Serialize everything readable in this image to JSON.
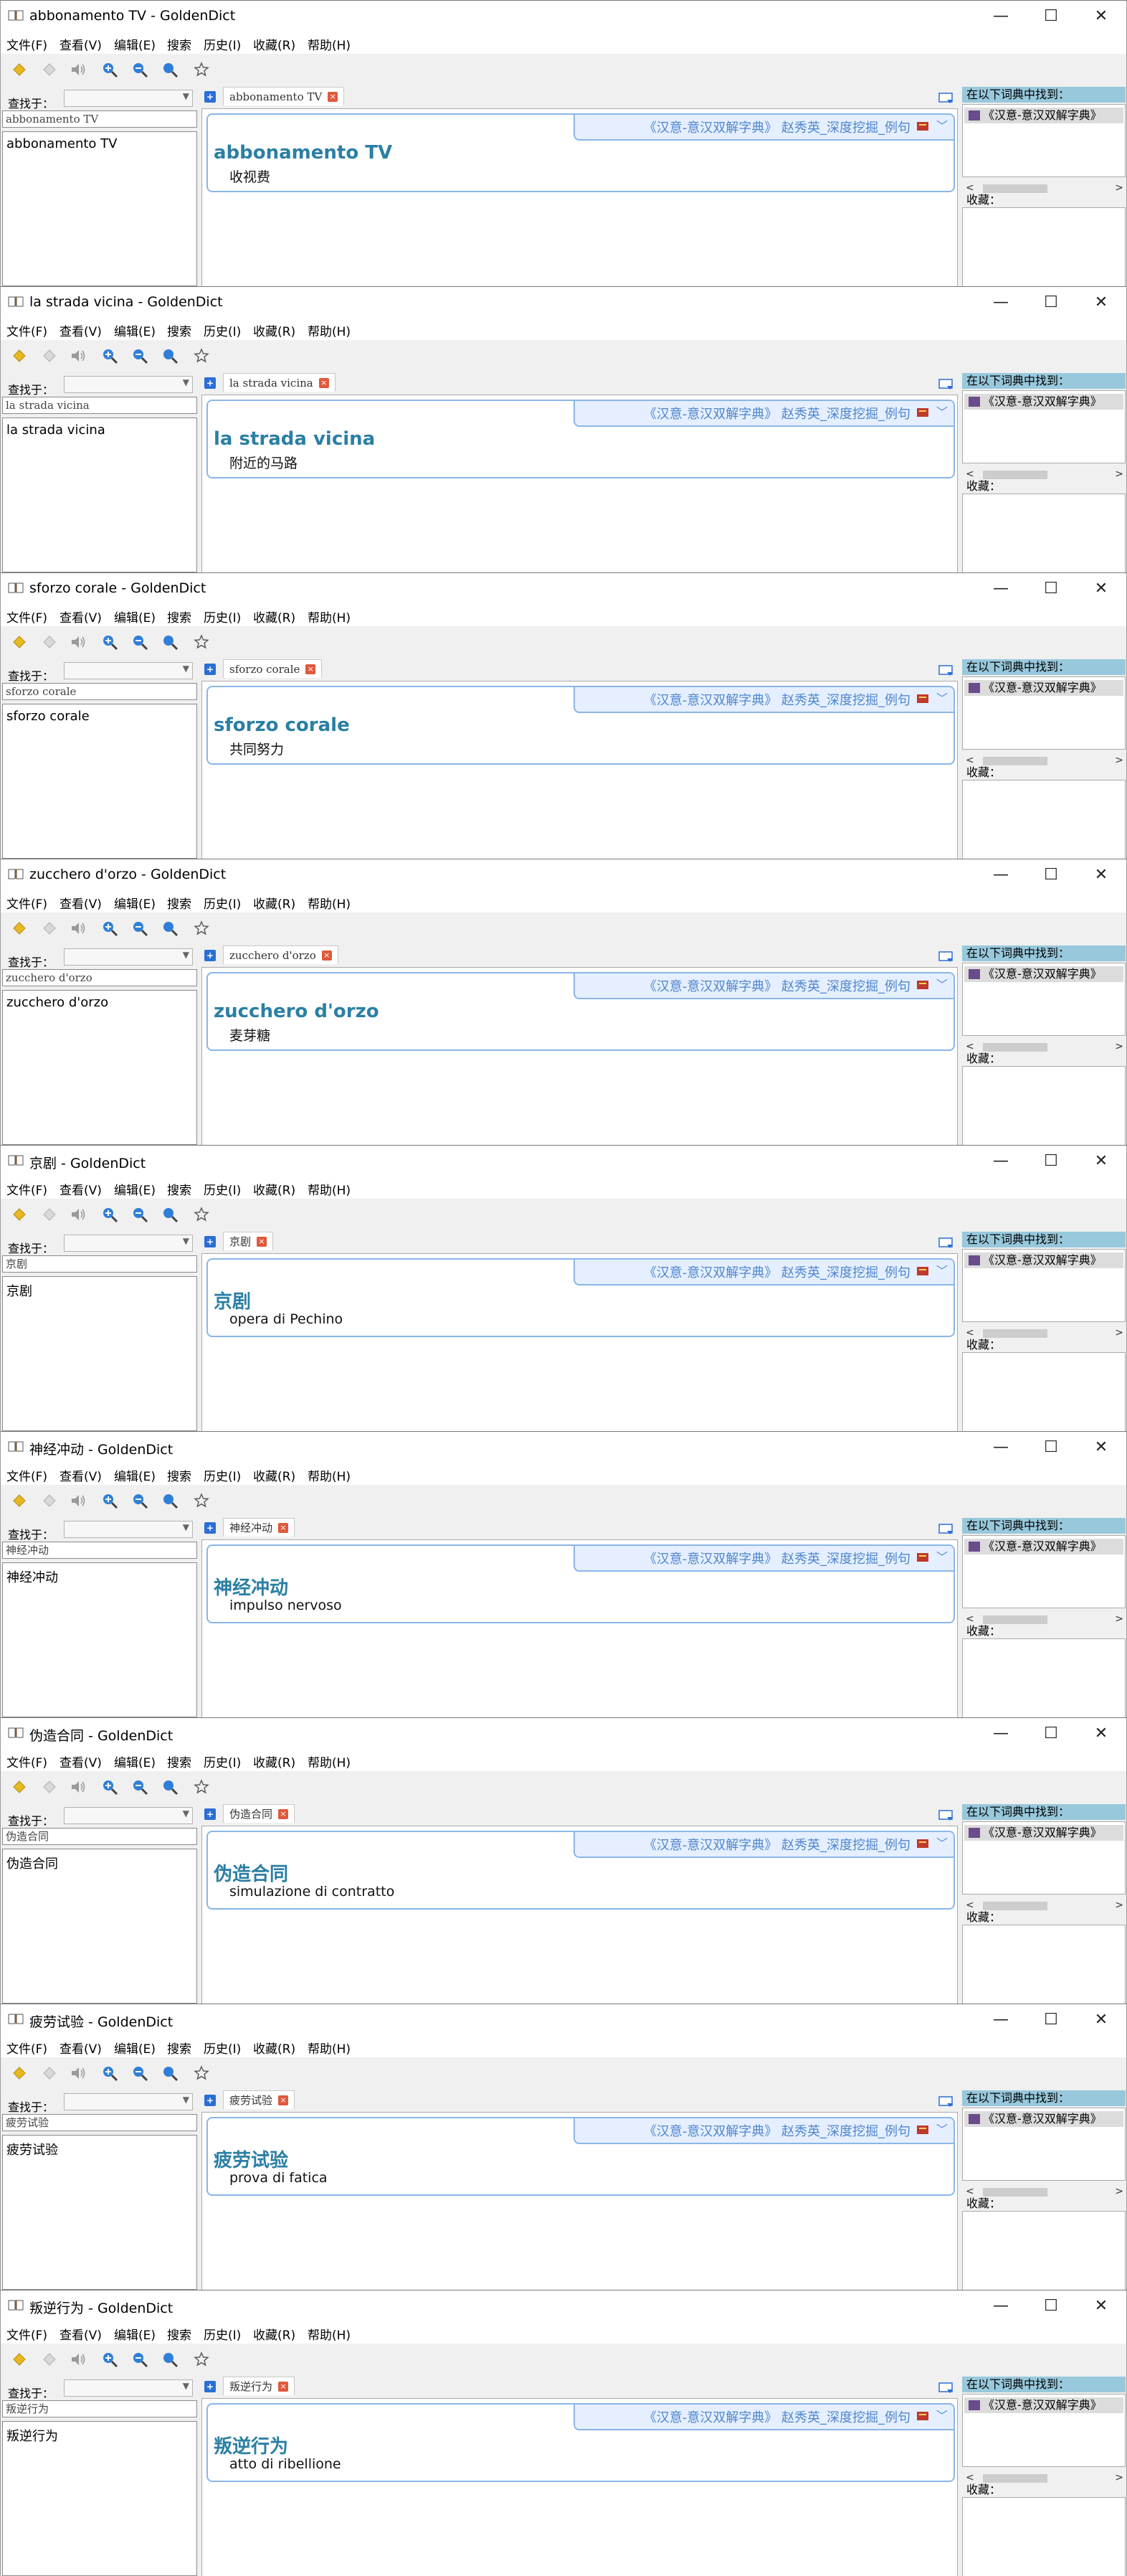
{
  "app": {
    "title_suffix": " - GoldenDict",
    "menu": [
      "文件(F)",
      "查看(V)",
      "编辑(E)",
      "搜索",
      "历史(I)",
      "收藏(R)",
      "帮助(H)"
    ],
    "window_buttons": {
      "minimize": "—",
      "maximize": "☐",
      "close": "✕"
    },
    "look_in_label": "查找于：",
    "found_in_label": "在以下词典中找到：",
    "favorites_label": "收藏：",
    "dictionary_name": "《汉意-意汉双解字典》 赵秀英_深度挖掘_例句",
    "found_dictionary": "《汉意-意汉双解字典》",
    "tab_add": "+",
    "tab_close": "×",
    "colors": {
      "accent": "#2b7fa4",
      "dict_header_bg": "#e5efff",
      "dict_border": "#8ab6e8",
      "found_header_bg": "#98c8dc",
      "nav_arrow": "#e8b820",
      "magnifier": "#2f7fd8"
    },
    "toolbar_icons": [
      "back-arrow-icon",
      "forward-arrow-icon",
      "speaker-icon",
      "zoom-in-icon",
      "zoom-out-icon",
      "zoom-reset-icon",
      "favorite-star-icon"
    ]
  },
  "windows": [
    {
      "word": "abbonamento TV",
      "definition": "收视费"
    },
    {
      "word": "la strada vicina",
      "definition": "附近的马路"
    },
    {
      "word": "sforzo corale",
      "definition": "共同努力"
    },
    {
      "word": "zucchero d'orzo",
      "definition": "麦芽糖"
    },
    {
      "word": "京剧",
      "definition": "opera di Pechino"
    },
    {
      "word": "神经冲动",
      "definition": "impulso nervoso"
    },
    {
      "word": "伪造合同",
      "definition": "simulazione di contratto"
    },
    {
      "word": "疲劳试验",
      "definition": "prova di fatica"
    },
    {
      "word": "叛逆行为",
      "definition": "atto di ribellione"
    }
  ]
}
